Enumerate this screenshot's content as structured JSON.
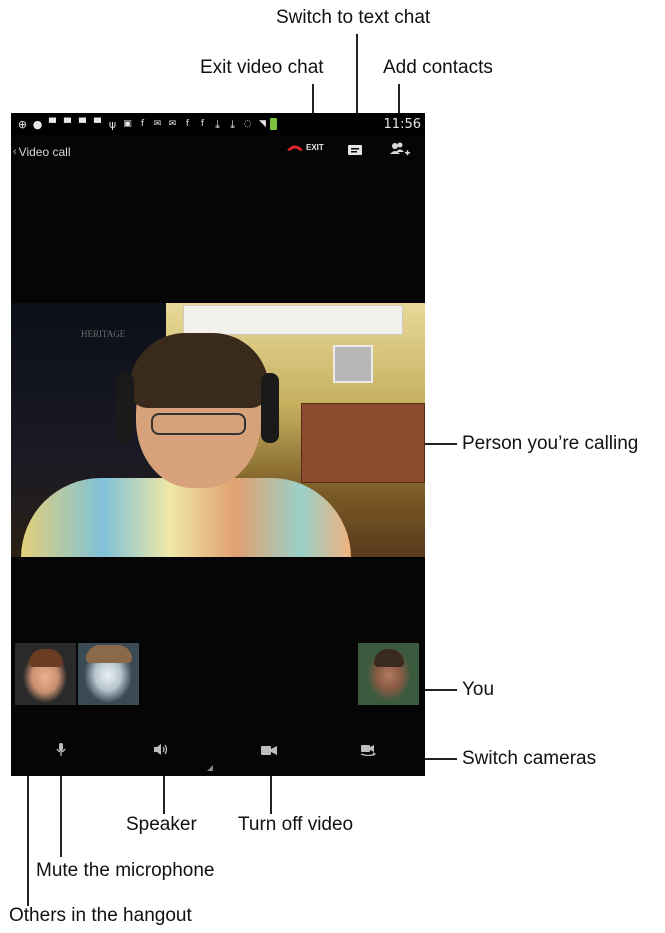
{
  "callouts": {
    "switch_to_text_chat": "Switch to text chat",
    "exit_video_chat": "Exit video chat",
    "add_contacts": "Add contacts",
    "person_youre_calling": "Person you’re calling",
    "you": "You",
    "switch_cameras": "Switch cameras",
    "speaker": "Speaker",
    "turn_off_video": "Turn off video",
    "mute_the_microphone": "Mute the microphone",
    "others_in_the_hangout": "Others in the hangout"
  },
  "status_bar": {
    "time": "11:56",
    "battery_color": "#7dc141",
    "icons": [
      "add-icon",
      "chat-bubble-icon",
      "talk-icon",
      "talk-icon",
      "talk-icon",
      "talk-icon",
      "usb-icon",
      "gallery-icon",
      "facebook-icon",
      "gmail-icon",
      "gmail-icon",
      "facebook-icon",
      "facebook-icon",
      "download-icon",
      "download-icon",
      "nfc-icon",
      "wifi-icon",
      "battery-icon"
    ]
  },
  "action_bar": {
    "back_label": "Video call",
    "exit_label": "EXIT",
    "exit_icon_color": "#e0262b"
  },
  "main_video": {
    "background_sign": "HERITAGE"
  },
  "thumbnails": [
    "participant-1",
    "participant-2",
    "self-view"
  ],
  "controls": [
    "mic-icon",
    "speaker-icon",
    "video-camera-icon",
    "switch-camera-icon"
  ]
}
